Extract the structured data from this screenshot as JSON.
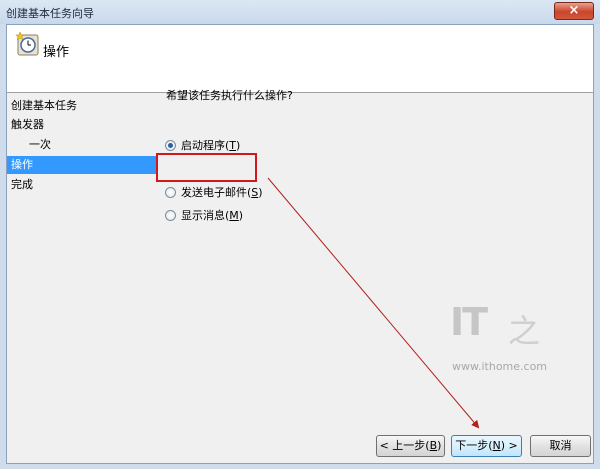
{
  "window": {
    "title": "创建基本任务向导",
    "close_glyph": "×"
  },
  "header": {
    "title": "操作",
    "icon": "task-clock-icon"
  },
  "sidebar": {
    "items": [
      {
        "label": "创建基本任务",
        "active": false
      },
      {
        "label": "触发器",
        "active": false
      },
      {
        "label": "一次",
        "active": false
      },
      {
        "label": "操作",
        "active": true
      },
      {
        "label": "完成",
        "active": false
      }
    ]
  },
  "main": {
    "question": "希望该任务执行什么操作?",
    "options": [
      {
        "label": "启动程序(",
        "key": "T",
        "suffix": ")",
        "selected": true
      },
      {
        "label": "发送电子邮件(",
        "key": "S",
        "suffix": ")",
        "selected": false
      },
      {
        "label": "显示消息(",
        "key": "M",
        "suffix": ")",
        "selected": false
      }
    ]
  },
  "watermark": {
    "logo": "IT",
    "char": "之",
    "url": "www.ithome.com"
  },
  "buttons": {
    "back": {
      "label": "< 上一步(",
      "key": "B",
      "suffix": ")"
    },
    "next": {
      "label": "下一步(",
      "key": "N",
      "suffix": ") >"
    },
    "cancel": {
      "label": "取消"
    }
  },
  "colors": {
    "highlight": "#d0191c",
    "selection": "#3399ff"
  }
}
